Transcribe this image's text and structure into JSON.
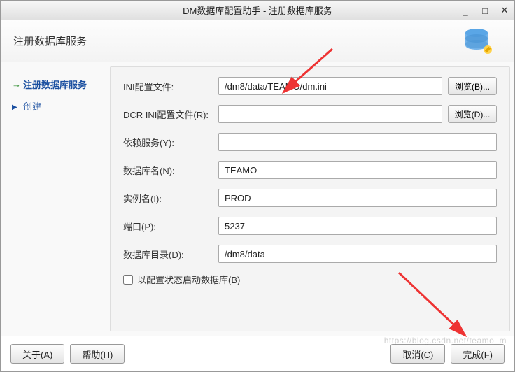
{
  "titlebar": {
    "title": "DM数据库配置助手 - 注册数据库服务"
  },
  "header": {
    "title": "注册数据库服务"
  },
  "sidebar": {
    "items": [
      {
        "label": "注册数据库服务"
      },
      {
        "label": "创建"
      }
    ]
  },
  "form": {
    "ini_label": "INI配置文件:",
    "ini_value": "/dm8/data/TEAMO/dm.ini",
    "ini_browse": "浏览(B)...",
    "dcr_label": "DCR INI配置文件(R):",
    "dcr_value": "",
    "dcr_browse": "浏览(D)...",
    "dep_label": "依赖服务(Y):",
    "dep_value": "",
    "dbname_label": "数据库名(N):",
    "dbname_value": "TEAMO",
    "inst_label": "实例名(I):",
    "inst_value": "PROD",
    "port_label": "端口(P):",
    "port_value": "5237",
    "dir_label": "数据库目录(D):",
    "dir_value": "/dm8/data",
    "checkbox_label": "以配置状态启动数据库(B)"
  },
  "footer": {
    "about": "关于(A)",
    "help": "帮助(H)",
    "cancel": "取消(C)",
    "finish": "完成(F)"
  },
  "watermark": "https://blog.csdn.net/teamo_m"
}
